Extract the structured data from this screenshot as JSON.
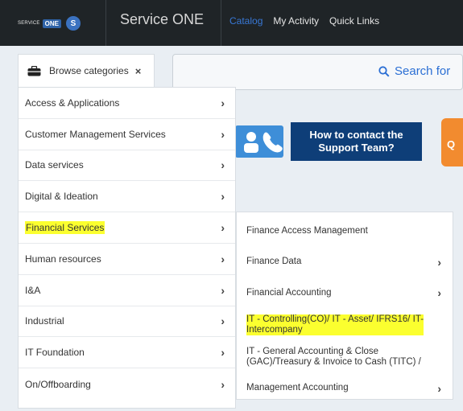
{
  "navbar": {
    "logo_small": "SERVICE",
    "logo_one": "ONE",
    "logo_circle": "S",
    "title": "Service ONE",
    "links": [
      "Catalog",
      "My Activity",
      "Quick Links"
    ]
  },
  "search": {
    "label": "Search for"
  },
  "contact": {
    "line1": "How to contact the",
    "line2": "Support Team?",
    "q": "Q"
  },
  "browse": {
    "label": "Browse categories",
    "close": "×"
  },
  "categories": [
    {
      "label": "Access & Applications"
    },
    {
      "label": "Customer Management Services"
    },
    {
      "label": "Data services"
    },
    {
      "label": "Digital & Ideation"
    },
    {
      "label": "Financial Services"
    },
    {
      "label": "Human resources"
    },
    {
      "label": "I&A"
    },
    {
      "label": "Industrial"
    },
    {
      "label": "IT Foundation"
    },
    {
      "label": "On/Offboarding"
    }
  ],
  "subcategories": [
    {
      "label": "Finance Access Management",
      "line2": ""
    },
    {
      "label": "Finance Data",
      "line2": ""
    },
    {
      "label": "Financial Accounting",
      "line2": ""
    },
    {
      "label": "IT - Controlling(CO)/ IT - Asset/ IFRS16/ IT-",
      "line2": "Intercompany"
    },
    {
      "label": "IT - General Accounting & Close",
      "line2": "(GAC)/Treasury & Invoice to Cash (TITC) /"
    },
    {
      "label": "Management Accounting",
      "line2": ""
    }
  ],
  "chevron": "›",
  "colors": {
    "highlight": "#fbff2f",
    "navbar": "#1f2427",
    "accent": "#3878d6"
  }
}
